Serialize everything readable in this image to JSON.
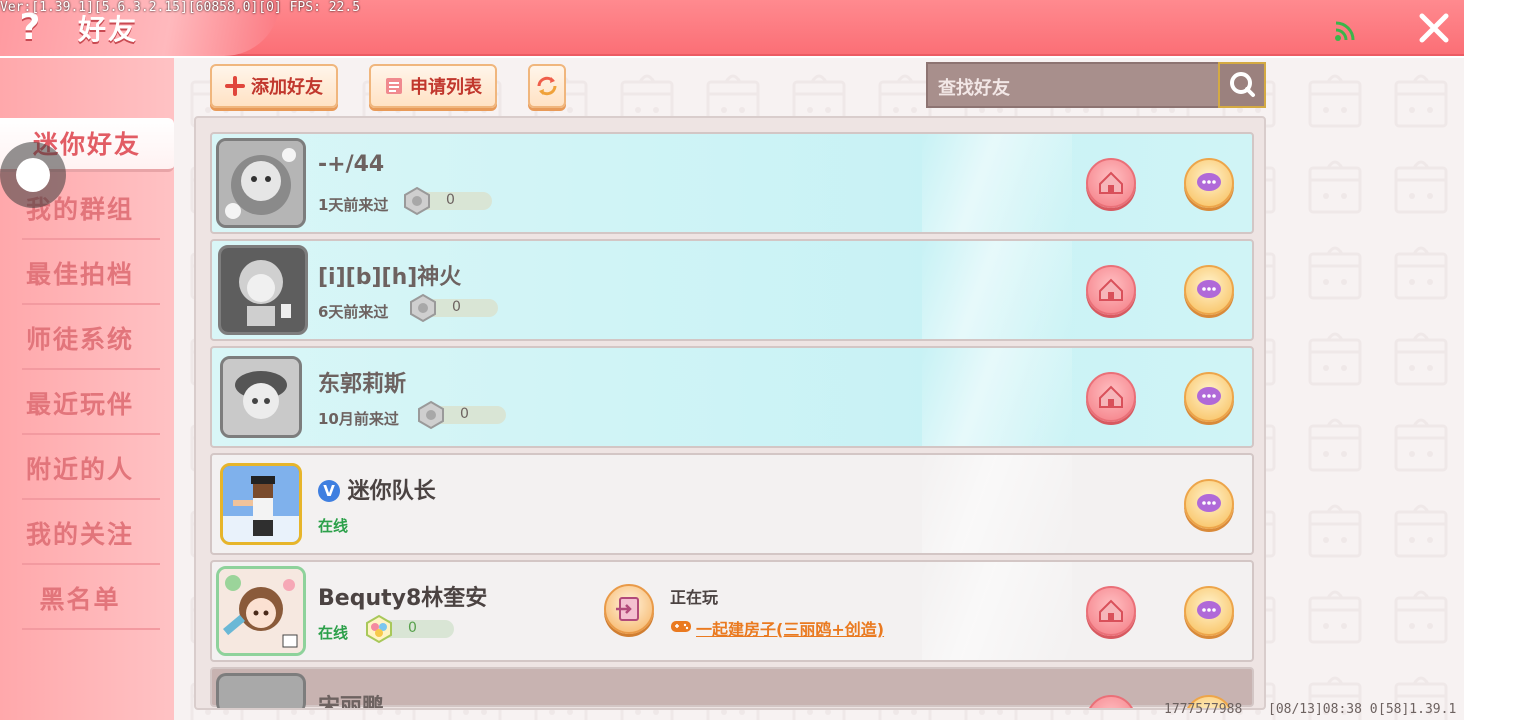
{
  "header": {
    "title": "好友",
    "help_label": "?",
    "debug": "Ver:[1.39.1][5.6.3.2.15][60858,0][0] FPS: 22.5"
  },
  "sidebar": {
    "items": [
      {
        "label": "迷你好友",
        "active": true
      },
      {
        "label": "我的群组"
      },
      {
        "label": "最佳拍档"
      },
      {
        "label": "师徒系统"
      },
      {
        "label": "最近玩伴"
      },
      {
        "label": "附近的人"
      },
      {
        "label": "我的关注"
      },
      {
        "label": "黑名单"
      }
    ]
  },
  "toolbar": {
    "add_friend": "添加好友",
    "request_list": "申请列表",
    "search_placeholder": "查找好友"
  },
  "friends": [
    {
      "name": "-+/44",
      "status": "1天前来过",
      "badge": "0"
    },
    {
      "name": "[i][b][h]神火",
      "status": "6天前来过",
      "badge": "0"
    },
    {
      "name": "东郭莉斯",
      "status": "10月前来过",
      "badge": "0"
    },
    {
      "name": "迷你队长",
      "status": "在线",
      "verified": "V"
    },
    {
      "name": "Bequty8林奎安",
      "status": "在线",
      "badge": "0",
      "playing_label": "正在玩",
      "playing_game": "一起建房子(三丽鸥+创造)"
    },
    {
      "name": "宋丽鹏"
    }
  ],
  "footer": {
    "uid": "1777577988",
    "time": "[08/13]08:38 0",
    "version": "[58]1.39.1"
  },
  "colors": {
    "header": "#fb6f76",
    "sidebar": "#ffb3b6",
    "online": "#2ca04a",
    "game_link": "#ea7a20"
  }
}
